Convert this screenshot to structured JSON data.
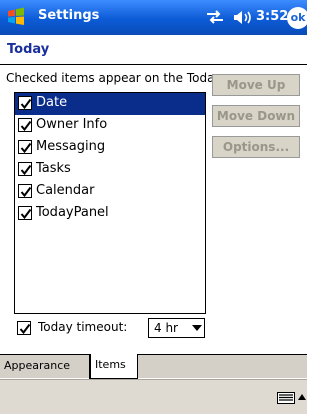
{
  "titlebar": {
    "app_title": "Settings",
    "time": "3:52",
    "ok_label": "ok",
    "icons": [
      "windows-start-icon",
      "connectivity-icon",
      "speaker-icon"
    ]
  },
  "page": {
    "title": "Today",
    "instructions": "Checked items appear on the Today screen."
  },
  "items": [
    {
      "label": "Date",
      "checked": true,
      "selected": true
    },
    {
      "label": "Owner Info",
      "checked": true,
      "selected": false
    },
    {
      "label": "Messaging",
      "checked": true,
      "selected": false
    },
    {
      "label": "Tasks",
      "checked": true,
      "selected": false
    },
    {
      "label": "Calendar",
      "checked": true,
      "selected": false
    },
    {
      "label": "TodayPanel",
      "checked": true,
      "selected": false
    }
  ],
  "buttons": {
    "move_up": "Move Up",
    "move_down": "Move Down",
    "options": "Options...",
    "enabled": false
  },
  "timeout": {
    "checked": true,
    "label": "Today timeout:",
    "value": "4 hr"
  },
  "tabs": [
    {
      "label": "Appearance",
      "active": false
    },
    {
      "label": "Items",
      "active": true
    }
  ],
  "bottombar": {
    "icons": [
      "keyboard-icon",
      "input-menu-arrow-icon"
    ]
  },
  "colors": {
    "title_bar": "#0c5bd6",
    "selection": "#0a2d8c",
    "page_title": "#1a2f9a",
    "disabled_text": "#9a9688"
  }
}
